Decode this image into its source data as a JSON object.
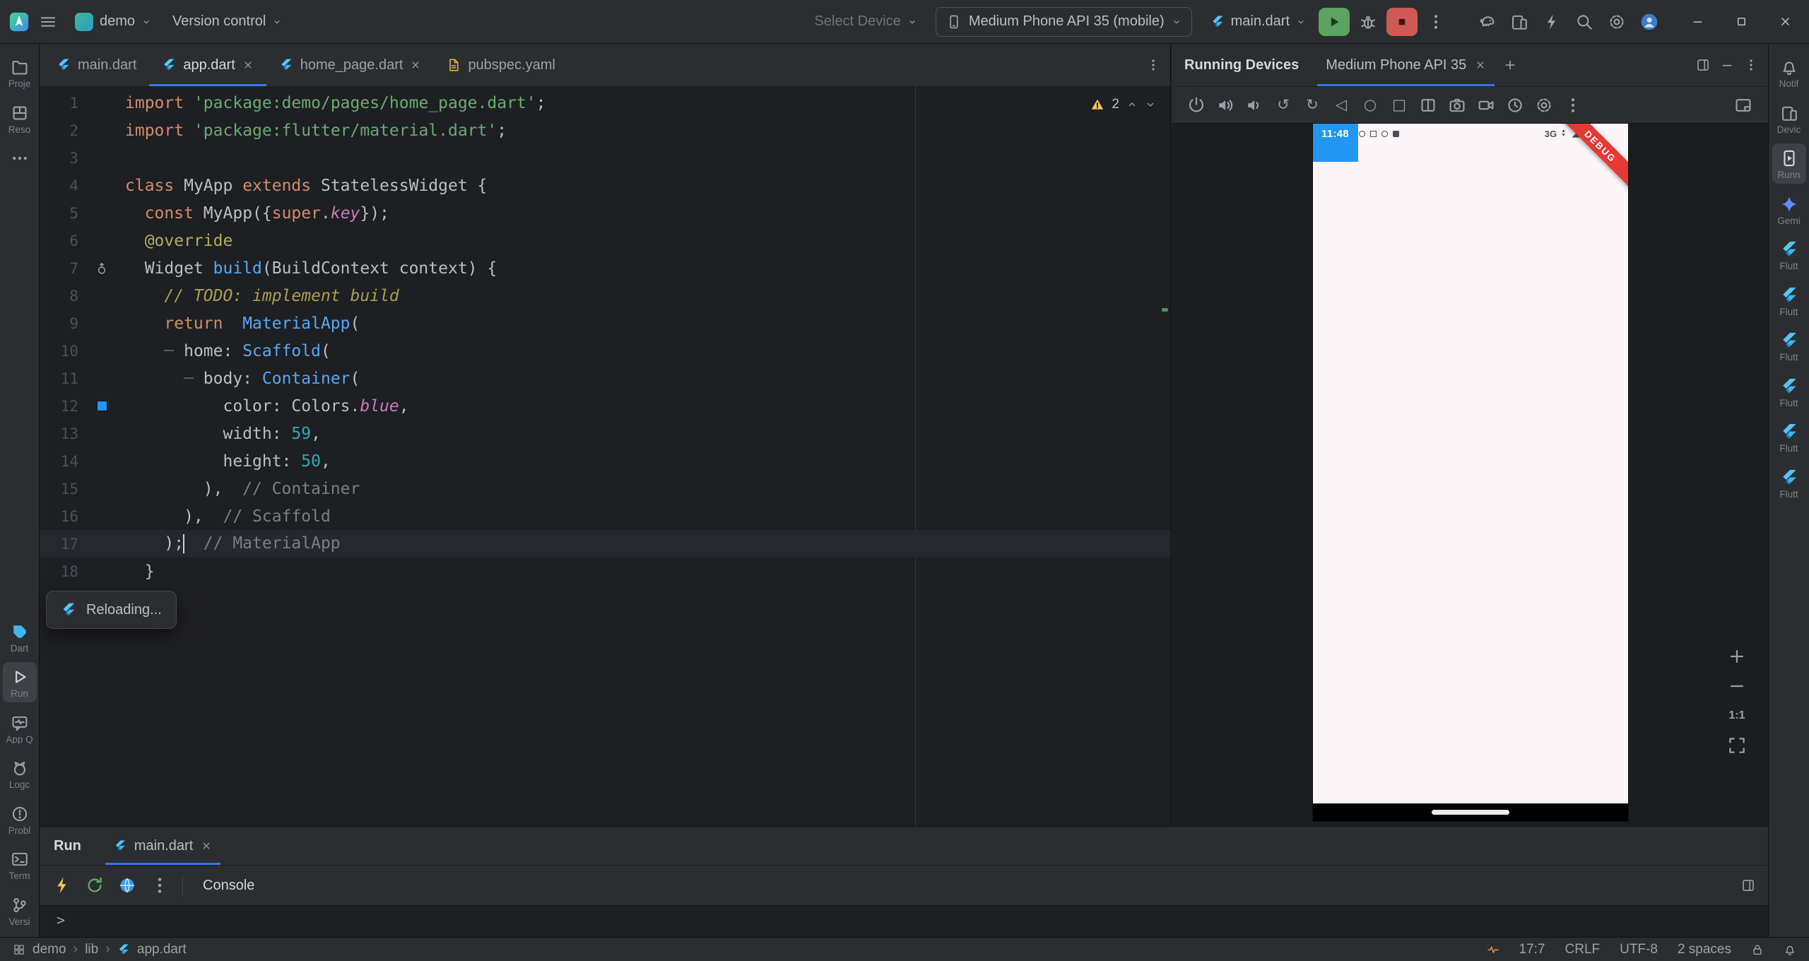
{
  "titlebar": {
    "project": "demo",
    "vcs_label": "Version control",
    "select_device_label": "Select Device",
    "device_label": "Medium Phone API 35 (mobile)",
    "run_config_label": "main.dart",
    "right_icons": [
      {
        "name": "build",
        "icon": "gradle-icon"
      },
      {
        "name": "device-manager",
        "icon": "devices-icon"
      },
      {
        "name": "apply-changes",
        "icon": "lightning-icon"
      },
      {
        "name": "search-everywhere",
        "icon": "search-icon"
      },
      {
        "name": "settings",
        "icon": "gear-icon"
      },
      {
        "name": "profile",
        "icon": "avatar-icon"
      }
    ]
  },
  "left_stripe": {
    "top": [
      {
        "name": "project",
        "label": "Proje",
        "icon": "folder-icon"
      },
      {
        "name": "resource-manager",
        "label": "Reso",
        "icon": "box-icon"
      },
      {
        "name": "more-tool-windows",
        "label": "",
        "icon": "more-horizontal-icon"
      }
    ],
    "bottom": [
      {
        "name": "dart-analysis",
        "label": "Dart",
        "icon": "dart-icon"
      },
      {
        "name": "run",
        "label": "Run",
        "icon": "play-outline-icon",
        "active": true
      },
      {
        "name": "app-quality-insights",
        "label": "App Q",
        "icon": "app-insights-icon"
      },
      {
        "name": "logcat",
        "label": "Logc",
        "icon": "logcat-icon"
      },
      {
        "name": "problems",
        "label": "Probl",
        "icon": "problems-icon"
      },
      {
        "name": "terminal",
        "label": "Term",
        "icon": "terminal-icon"
      },
      {
        "name": "version-control",
        "label": "Versi",
        "icon": "vcs-icon"
      }
    ]
  },
  "right_stripe": [
    {
      "name": "notifications",
      "label": "Notif",
      "icon": "bell-icon"
    },
    {
      "name": "device-manager",
      "label": "Devic",
      "icon": "devices-icon"
    },
    {
      "name": "running-devices",
      "label": "Runn",
      "icon": "phone-play-icon",
      "active": true
    },
    {
      "name": "gemini",
      "label": "Gemi",
      "icon": "gemini-icon"
    },
    {
      "name": "flutter-outline",
      "label": "Flutt",
      "icon": "flutter-icon"
    },
    {
      "name": "flutter-performance",
      "label": "Flutt",
      "icon": "flutter-icon"
    },
    {
      "name": "flutter-inspector",
      "label": "Flutt",
      "icon": "flutter-icon"
    },
    {
      "name": "flutter-coverage",
      "label": "Flutt",
      "icon": "flutter-icon"
    },
    {
      "name": "flutter-extra-1",
      "label": "Flutt",
      "icon": "flutter-icon"
    },
    {
      "name": "flutter-extra-2",
      "label": "Flutt",
      "icon": "flutter-icon"
    }
  ],
  "editor": {
    "tabs": [
      {
        "label": "main.dart",
        "icon": "flutter-icon",
        "active": false,
        "closable": false
      },
      {
        "label": "app.dart",
        "icon": "flutter-icon",
        "active": true,
        "closable": true
      },
      {
        "label": "home_page.dart",
        "icon": "flutter-icon",
        "active": false,
        "closable": true
      },
      {
        "label": "pubspec.yaml",
        "icon": "pubspec-icon",
        "active": false,
        "closable": false
      }
    ],
    "warning_count": "2",
    "caret_line": 17,
    "reloading_text": "Reloading...",
    "lines": [
      {
        "n": 1,
        "tk": [
          [
            "kw",
            "import"
          ],
          [
            "pl",
            " "
          ],
          [
            "str",
            "'package:demo/pages/home_page.dart'"
          ],
          [
            "pl",
            ";"
          ]
        ]
      },
      {
        "n": 2,
        "tk": [
          [
            "kw",
            "import"
          ],
          [
            "pl",
            " "
          ],
          [
            "str",
            "'package:flutter/material.dart'"
          ],
          [
            "pl",
            ";"
          ]
        ]
      },
      {
        "n": 3,
        "tk": []
      },
      {
        "n": 4,
        "tk": [
          [
            "kw",
            "class"
          ],
          [
            "pl",
            " MyApp "
          ],
          [
            "kw",
            "extends"
          ],
          [
            "pl",
            " StatelessWidget {"
          ]
        ]
      },
      {
        "n": 5,
        "tk": [
          [
            "pl",
            "  "
          ],
          [
            "kw",
            "const"
          ],
          [
            "pl",
            " MyApp({"
          ],
          [
            "kw",
            "super"
          ],
          [
            "pl",
            "."
          ],
          [
            "prop",
            "key"
          ],
          [
            "pl",
            "});"
          ]
        ]
      },
      {
        "n": 6,
        "tk": [
          [
            "pl",
            "  "
          ],
          [
            "ann",
            "@override"
          ]
        ]
      },
      {
        "n": 7,
        "g": "override",
        "tk": [
          [
            "pl",
            "  Widget "
          ],
          [
            "cls",
            "build"
          ],
          [
            "pl",
            "(BuildContext context) {"
          ]
        ]
      },
      {
        "n": 8,
        "tk": [
          [
            "pl",
            "    "
          ],
          [
            "todo",
            "// TODO: implement build"
          ]
        ]
      },
      {
        "n": 9,
        "tk": [
          [
            "pl",
            "    "
          ],
          [
            "kw",
            "return"
          ],
          [
            "pl",
            "  "
          ],
          [
            "cls",
            "MaterialApp"
          ],
          [
            "pl",
            "("
          ]
        ]
      },
      {
        "n": 10,
        "tk": [
          [
            "pl",
            "    "
          ],
          [
            "gd",
            "─ "
          ],
          [
            "pl",
            "home: "
          ],
          [
            "cls",
            "Scaffold"
          ],
          [
            "pl",
            "("
          ]
        ]
      },
      {
        "n": 11,
        "tk": [
          [
            "pl",
            "      "
          ],
          [
            "gd",
            "─ "
          ],
          [
            "pl",
            "body: "
          ],
          [
            "cls",
            "Container"
          ],
          [
            "pl",
            "("
          ]
        ]
      },
      {
        "n": 12,
        "g": "swatch",
        "tk": [
          [
            "pl",
            "          color: Colors."
          ],
          [
            "prop",
            "blue"
          ],
          [
            "pl",
            ","
          ]
        ]
      },
      {
        "n": 13,
        "tk": [
          [
            "pl",
            "          width: "
          ],
          [
            "num",
            "59"
          ],
          [
            "pl",
            ","
          ]
        ]
      },
      {
        "n": 14,
        "tk": [
          [
            "pl",
            "          height: "
          ],
          [
            "num",
            "50"
          ],
          [
            "pl",
            ","
          ]
        ]
      },
      {
        "n": 15,
        "tk": [
          [
            "pl",
            "        ),  "
          ],
          [
            "cmt",
            "// Container"
          ]
        ]
      },
      {
        "n": 16,
        "tk": [
          [
            "pl",
            "      ),  "
          ],
          [
            "cmt",
            "// Scaffold"
          ]
        ]
      },
      {
        "n": 17,
        "tk": [
          [
            "pl",
            "    );"
          ],
          [
            "caret",
            ""
          ],
          [
            "pl",
            "  "
          ],
          [
            "cmt",
            "// MaterialApp"
          ]
        ]
      },
      {
        "n": 18,
        "tk": [
          [
            "pl",
            "  }"
          ]
        ]
      }
    ]
  },
  "device_panel": {
    "title": "Running Devices",
    "tab_label": "Medium Phone API 35",
    "toolbar_icons": [
      "power-icon",
      "volume-up-icon",
      "volume-down-icon",
      "rotate-left-icon",
      "rotate-right-icon",
      "back-icon",
      "home-icon",
      "overview-icon",
      "fold-icon",
      "camera-icon",
      "record-icon",
      "history-icon",
      "gear-icon",
      "more-vertical-icon"
    ],
    "dock_icon": "dock-icon",
    "screen": {
      "time": "11:48",
      "network_label": "3G",
      "debug_banner": "DEBUG",
      "container_color": "#2196F3",
      "background_color": "#FCF5F8"
    },
    "zoom_label": "1:1"
  },
  "run_panel": {
    "title": "Run",
    "tab_label": "main.dart",
    "console_label": "Console",
    "prompt": ">",
    "toolbar": [
      {
        "name": "flutter-hot-reload",
        "icon": "lightning-icon",
        "color": "#F2C55C"
      },
      {
        "name": "flutter-hot-restart",
        "icon": "restart-icon",
        "color": "#6AAB73"
      },
      {
        "name": "open-devtools",
        "icon": "globe-icon",
        "color": "#2E9BF0"
      },
      {
        "name": "more-options",
        "icon": "more-vertical-icon",
        "color": "#9DA0A8"
      }
    ]
  },
  "statusbar": {
    "breadcrumbs": [
      "demo",
      "lib",
      "app.dart"
    ],
    "caret_position": "17:7",
    "line_separator": "CRLF",
    "encoding": "UTF-8",
    "indent": "2 spaces"
  }
}
